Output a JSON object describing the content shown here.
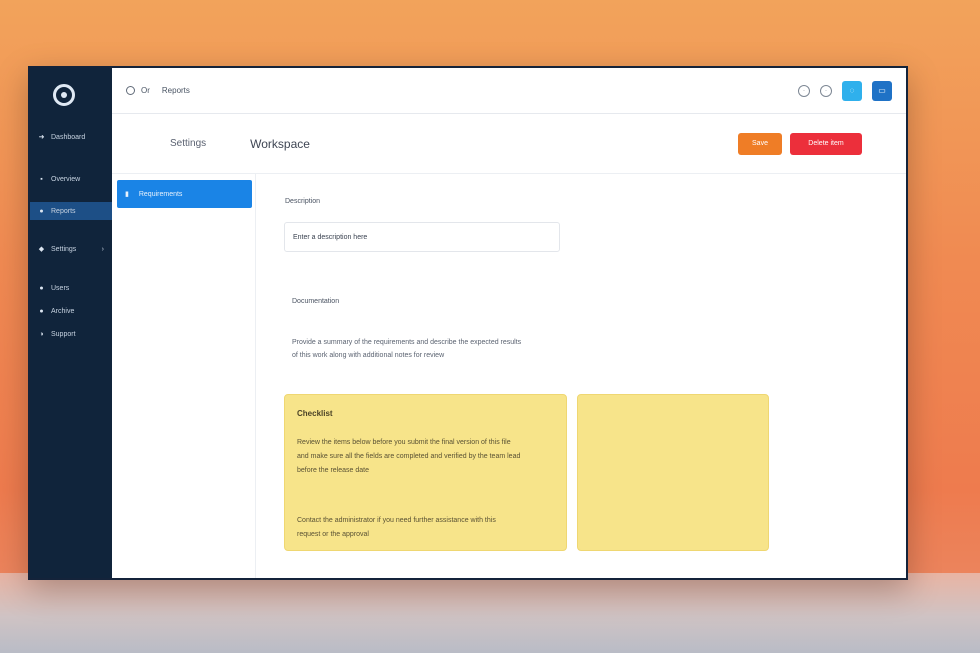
{
  "nav": {
    "items": [
      {
        "icon": "arrow-icon",
        "label": "Dashboard"
      },
      {
        "icon": "grid-icon",
        "label": "Overview"
      },
      {
        "icon": "document-icon",
        "label": "Reports",
        "active": true
      },
      {
        "icon": "settings-icon",
        "label": "Settings",
        "expandable": true
      },
      {
        "icon": "user-icon",
        "label": "Users"
      },
      {
        "icon": "folder-icon",
        "label": "Archive"
      },
      {
        "icon": "help-icon",
        "label": "Support"
      }
    ]
  },
  "topbar": {
    "breadcrumb_1": "Or",
    "breadcrumb_2": "Reports",
    "icons": [
      "circle-icon",
      "circle-icon",
      "info-icon",
      "apps-icon"
    ],
    "accent": "#2f9de0",
    "accent_secondary": "#1f72c6"
  },
  "header": {
    "section": "Settings",
    "page_title": "Workspace",
    "action_secondary": "Save",
    "action_primary": "Delete item"
  },
  "subnav": {
    "active_item": "Requirements"
  },
  "form": {
    "field_label": "Description",
    "field_value": "Enter a description here"
  },
  "section": {
    "title": "Documentation",
    "desc_line1": "Provide a summary of the requirements and describe the expected results",
    "desc_line2": "of this work along with additional notes for review"
  },
  "note_card": {
    "title": "Checklist",
    "line1": "Review the items below before you submit the final version of this file",
    "line2": "and make sure all the fields are completed and verified by the team lead",
    "line3": "before the release date",
    "line4": "Contact the administrator if you need further assistance with this",
    "line5": "request or the approval"
  },
  "colors": {
    "sidebar_bg": "#10243b",
    "nav_active": "#1d4f86",
    "subnav_active": "#1a84e6",
    "btn_orange": "#ef7d26",
    "btn_red": "#ec2f3b",
    "card_yellow": "#f7e48a"
  }
}
